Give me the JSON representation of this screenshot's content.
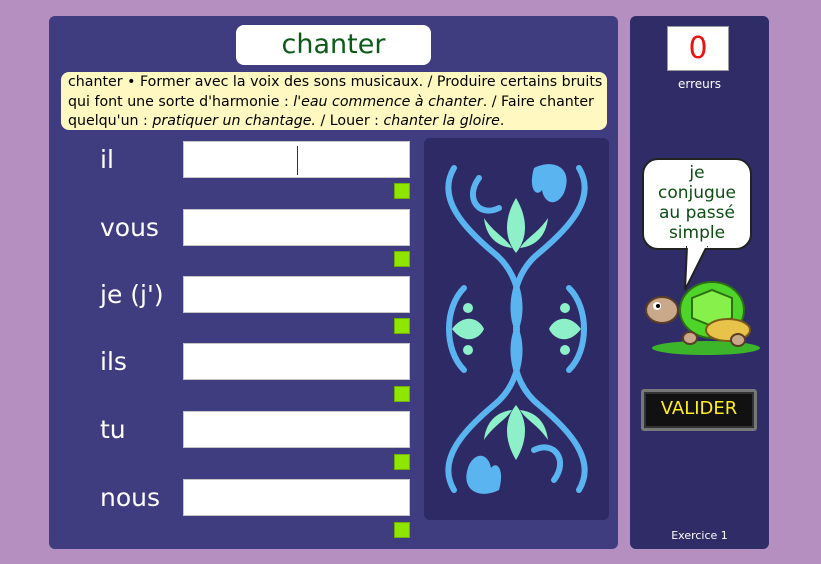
{
  "verb": "chanter",
  "definition": {
    "head": "chanter • Former avec la voix des sons musicaux. / Produire certains bruits qui font une sorte d'harmonie :",
    "ex1": "l'eau commence à chanter",
    "mid1": ". / Faire chanter quelqu'un :",
    "ex2": "pratiquer un chantage.",
    "mid2": "/ Louer :",
    "ex3": "chanter la gloire",
    "tail": "."
  },
  "rows": [
    {
      "pronoun": "il",
      "value": ""
    },
    {
      "pronoun": "vous",
      "value": ""
    },
    {
      "pronoun": "je (j')",
      "value": ""
    },
    {
      "pronoun": "ils",
      "value": ""
    },
    {
      "pronoun": "tu",
      "value": ""
    },
    {
      "pronoun": "nous",
      "value": ""
    }
  ],
  "errors": {
    "count": "0",
    "label": "erreurs"
  },
  "bubble": {
    "lines": [
      "je",
      "conjugue",
      "au passé",
      "simple"
    ]
  },
  "validate_label": "VALIDER",
  "exercise_label": "Exercice 1",
  "colors": {
    "background": "#b48fbf",
    "panel": "#3f3d80",
    "side_panel": "#2f2c67",
    "status_ok": "#8fe500",
    "ornament_blue": "#5ab4f0",
    "ornament_green": "#8ef0c8"
  },
  "icons": {
    "ornament": "ornament-icon",
    "turtle": "turtle-icon"
  }
}
